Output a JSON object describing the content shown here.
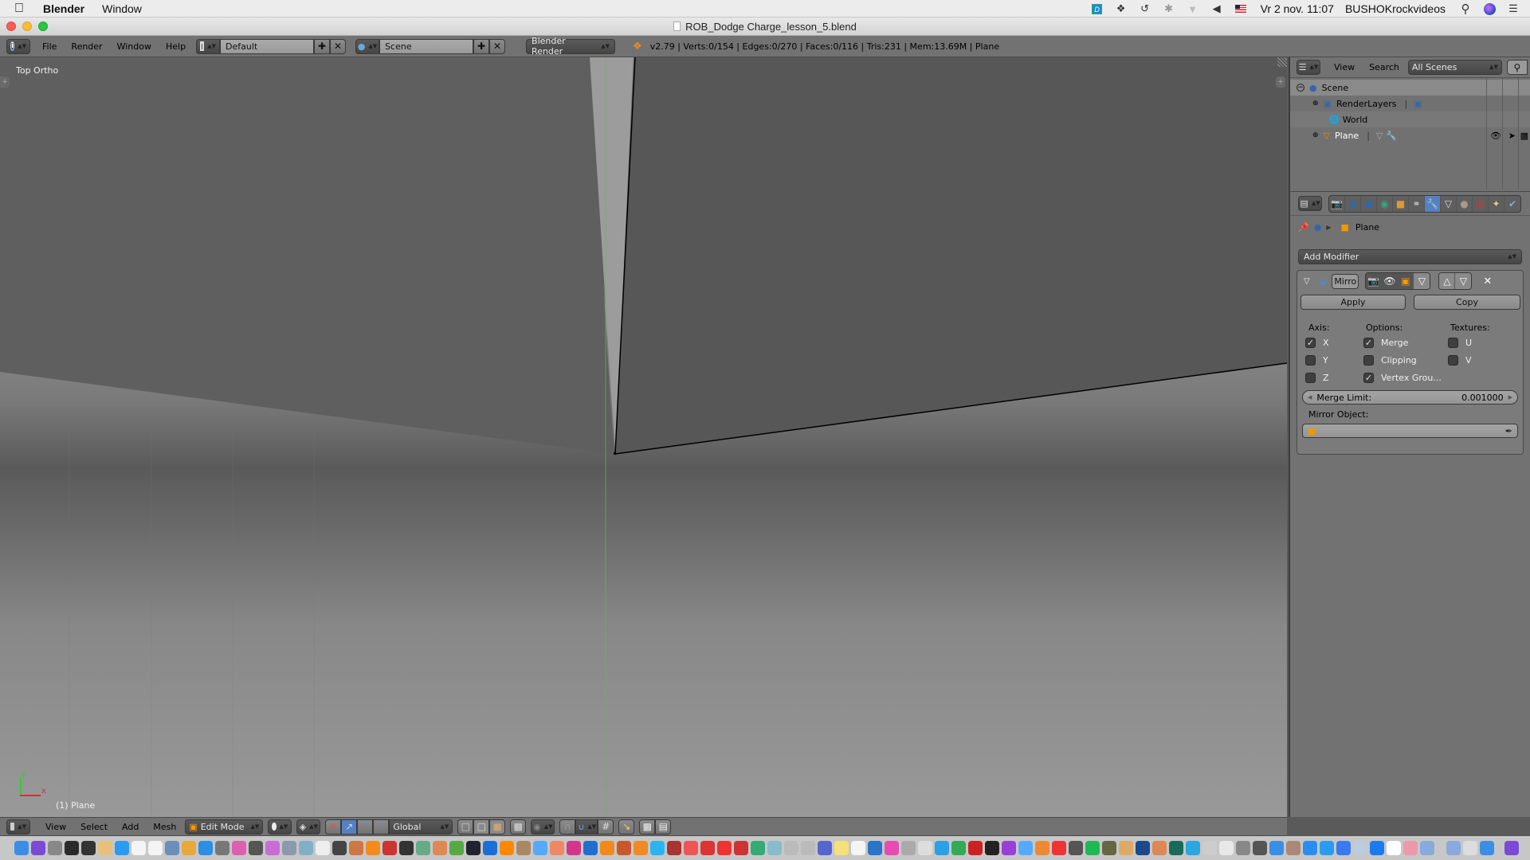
{
  "menubar": {
    "app_name": "Blender",
    "menus": [
      "Window"
    ],
    "status_icons": [
      "dashlane-icon",
      "dropbox-icon",
      "time-machine-icon",
      "bluetooth-icon",
      "wifi-icon",
      "volume-icon",
      "us-flag-input-icon"
    ],
    "datetime": "Vr 2 nov.  11:07",
    "username": "BUSHOKrockvideos"
  },
  "window": {
    "title": "ROB_Dodge Charge_lesson_5.blend"
  },
  "info_header": {
    "menus": [
      "File",
      "Render",
      "Window",
      "Help"
    ],
    "screen_layout": "Default",
    "scene": "Scene",
    "render_engine": "Blender Render",
    "stats": "v2.79 | Verts:0/154 | Edges:0/270 | Faces:0/116 | Tris:231 | Mem:13.69M | Plane"
  },
  "viewport": {
    "view_label": "Top Ortho",
    "object_label": "(1) Plane",
    "axis_x": "x",
    "axis_y": "y",
    "colors": {
      "x_axis": "#d03030",
      "y_axis": "#40c040",
      "edge": "#000000"
    }
  },
  "view3d_header": {
    "menus": [
      "View",
      "Select",
      "Add",
      "Mesh"
    ],
    "mode": "Edit Mode",
    "orientation": "Global"
  },
  "outliner": {
    "menus": [
      "View",
      "Search"
    ],
    "display_mode": "All Scenes",
    "tree": [
      {
        "label": "Scene",
        "level": 0,
        "expanded": true
      },
      {
        "label": "RenderLayers",
        "level": 1
      },
      {
        "label": "World",
        "level": 1
      },
      {
        "label": "Plane",
        "level": 1
      }
    ]
  },
  "properties": {
    "context_tabs": [
      "render",
      "render-layers",
      "scene",
      "world",
      "object",
      "constraints",
      "modifiers",
      "data",
      "material",
      "texture",
      "particles",
      "physics"
    ],
    "active_tab": "modifiers",
    "breadcrumb": "Plane",
    "add_modifier_label": "Add Modifier",
    "modifier": {
      "name": "Mirro",
      "apply_label": "Apply",
      "copy_label": "Copy",
      "axis_header": "Axis:",
      "options_header": "Options:",
      "textures_header": "Textures:",
      "axis": [
        {
          "label": "X",
          "checked": true
        },
        {
          "label": "Y",
          "checked": false
        },
        {
          "label": "Z",
          "checked": false
        }
      ],
      "options": [
        {
          "label": "Merge",
          "checked": true
        },
        {
          "label": "Clipping",
          "checked": false
        },
        {
          "label": "Vertex Grou...",
          "checked": true
        }
      ],
      "textures": [
        {
          "label": "U",
          "checked": false
        },
        {
          "label": "V",
          "checked": false
        }
      ],
      "merge_limit_label": "Merge Limit:",
      "merge_limit_value": "0.001000",
      "mirror_object_label": "Mirror Object:",
      "mirror_object_value": ""
    },
    "accent_color": "#5680c2"
  },
  "dock": {
    "apps": [
      "Finder",
      "Siri",
      "Launchpad",
      "Mission Control",
      "Dashboard",
      "Mail Stamp",
      "App Store",
      "Calendar",
      "Reminders",
      "Preview",
      "Chrome",
      "Safari",
      "Script",
      "Xcode Tools",
      "Final Cut",
      "Color",
      "Image Capture",
      "Automator",
      "TextEdit",
      "Calculator",
      "Photo Booth",
      "Firefox",
      "Parrot",
      "XTI",
      "Screen",
      "Paint",
      "Party",
      "Claquette",
      "QuickTime",
      "VLC",
      "Books",
      "Image",
      "Photos",
      "InDesign",
      "Photoshop",
      "Illustrator",
      "Bridge",
      "Blender",
      "Snow",
      "Unfolder",
      "Pencil",
      "Sketchup",
      "Filezilla Cog",
      "Daemon",
      "Finder2",
      "Bartender",
      "Camera",
      "Preview2",
      "Photos2",
      "Joe Jim",
      "Notes",
      "Paper",
      "Copy",
      "iTunes",
      "Photo2",
      "Clock",
      "Dashlane",
      "Dreamweaver",
      "FileZilla",
      "Terminal",
      "Activity",
      "Affinity",
      "Final Frontier",
      "Burn",
      "Acrobat",
      "Compressor",
      "Spotify",
      "Radar",
      "Archive",
      "Home",
      "Keynote",
      "Time Machine",
      "AirDrop",
      "Tools",
      "Utility",
      "Disk",
      "Preferences",
      "Photos3",
      "GarageBand",
      "Flashlight",
      "Messages",
      "Skype",
      "Maps",
      "TeamViewer",
      "Word",
      "Download",
      "Applications",
      "Documents",
      "Trash"
    ]
  }
}
